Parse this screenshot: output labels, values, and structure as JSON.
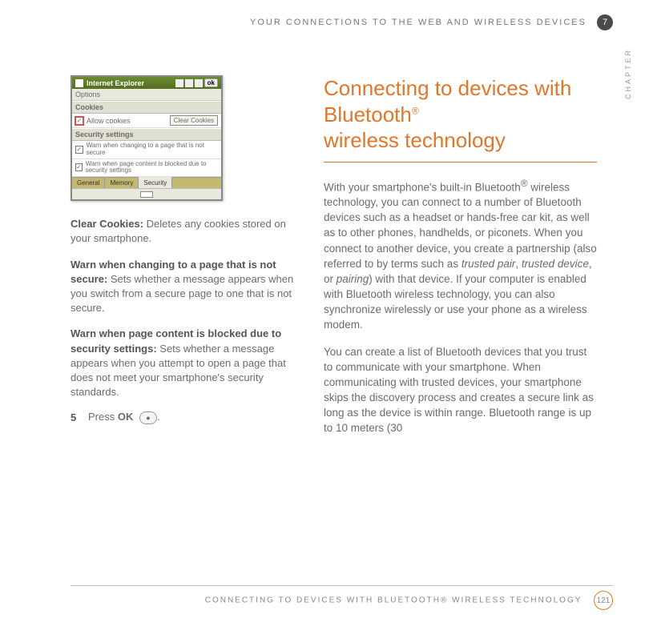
{
  "header": {
    "running_head": "YOUR CONNECTIONS TO THE WEB AND WIRELESS DEVICES",
    "chapter_number": "7",
    "chapter_label": "CHAPTER"
  },
  "screenshot": {
    "window_title": "Internet Explorer",
    "ok_label": "ok",
    "options_label": "Options",
    "section_cookies": "Cookies",
    "allow_cookies_label": "Allow cookies",
    "clear_cookies_button": "Clear Cookies",
    "section_security": "Security settings",
    "warn1": "Warn when changing to a page that is not secure",
    "warn2": "Warn when page content is blocked due to security settings",
    "tabs": {
      "general": "General",
      "memory": "Memory",
      "security": "Security"
    }
  },
  "left_column": {
    "para1": {
      "bold": "Clear Cookies:",
      "rest": " Deletes any cookies stored on your smartphone."
    },
    "para2": {
      "bold": "Warn when changing to a page that is not secure:",
      "rest": " Sets whether a message appears when you switch from a secure page to one that is not secure."
    },
    "para3": {
      "bold": "Warn when page content is blocked due to security settings:",
      "rest": " Sets whether a message appears when you attempt to open a page that does not meet your smartphone's security standards."
    },
    "step5": {
      "num": "5",
      "pre": "Press ",
      "bold": "OK",
      "post": " ",
      "key": "●"
    }
  },
  "right_column": {
    "heading_l1": "Connecting to devices with Bluetooth",
    "heading_l2": "wireless technology",
    "para1a": "With your smartphone's built-in Bluetooth",
    "para1b": " wireless technology, you can connect to a number of Bluetooth devices such as a headset or hands-free car kit, as well as to other phones, handhelds, or piconets. When you connect to another device, you create a partnership (also referred to by terms such as ",
    "para1_em1": "trusted pair",
    "para1_mid": ", ",
    "para1_em2": "trusted device",
    "para1_mid2": ", or ",
    "para1_em3": "pairing",
    "para1c": ") with that device. If your computer is enabled with Bluetooth wireless technology, you can also synchronize wirelessly or use your phone as a wireless modem.",
    "para2": "You can create a list of Bluetooth devices that you trust to communicate with your smartphone. When communicating with trusted devices, your smartphone skips the discovery process and creates a secure link as long as the device is within range. Bluetooth range is up to 10 meters (30"
  },
  "footer": {
    "running_foot": "CONNECTING TO DEVICES WITH BLUETOOTH® WIRELESS TECHNOLOGY",
    "page_number": "121"
  }
}
